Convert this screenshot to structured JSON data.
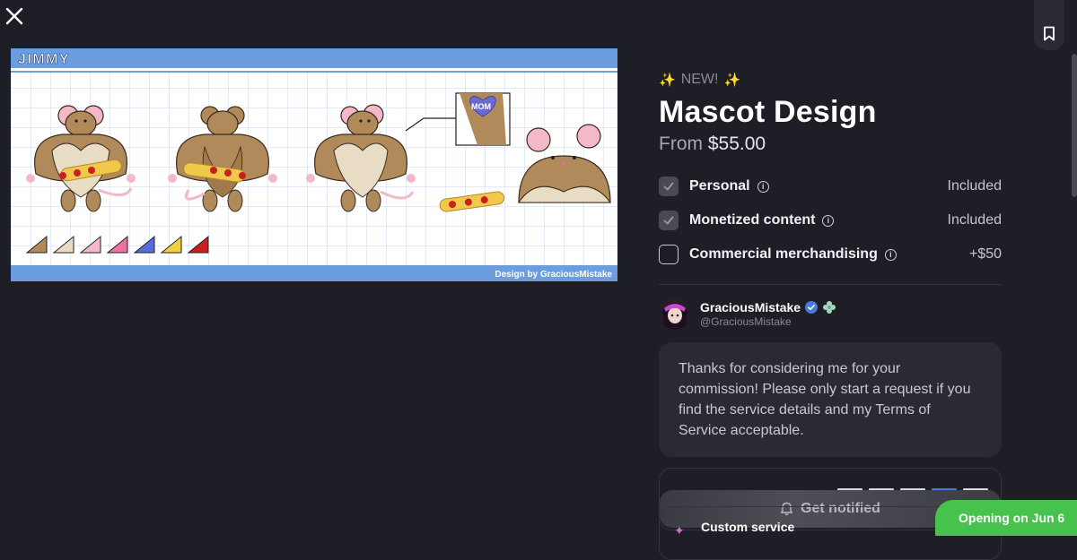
{
  "artwork": {
    "header_label": "JIMMY",
    "heart_text": "MOM",
    "credit": "Design by GraciousMistake"
  },
  "listing": {
    "badge": "NEW!",
    "title": "Mascot Design",
    "price_prefix": "From",
    "price": "$55.00"
  },
  "options": [
    {
      "label": "Personal",
      "value": "Included",
      "checked": true
    },
    {
      "label": "Monetized content",
      "value": "Included",
      "checked": true
    },
    {
      "label": "Commercial merchandising",
      "value": "+$50",
      "checked": false
    }
  ],
  "artist": {
    "name": "GraciousMistake",
    "handle": "@GraciousMistake"
  },
  "message": "Thanks for considering me for your commission! Please only start a request if you find the service details and my Terms of Service acceptable.",
  "notify": {
    "label": "Get notified"
  },
  "custom_service": {
    "title": "Custom service"
  },
  "opening_badge": "Opening on Jun 6",
  "colors": {
    "background": "#1e1e26",
    "card": "#2a2a32",
    "accent_green": "#47c24d",
    "verified_blue": "#4a7ad8",
    "artwork_header": "#6a9ee0"
  },
  "icons": [
    "close-icon",
    "bookmark-icon",
    "sparkle-icon",
    "check-icon",
    "info-icon",
    "verified-icon",
    "bell-icon"
  ]
}
